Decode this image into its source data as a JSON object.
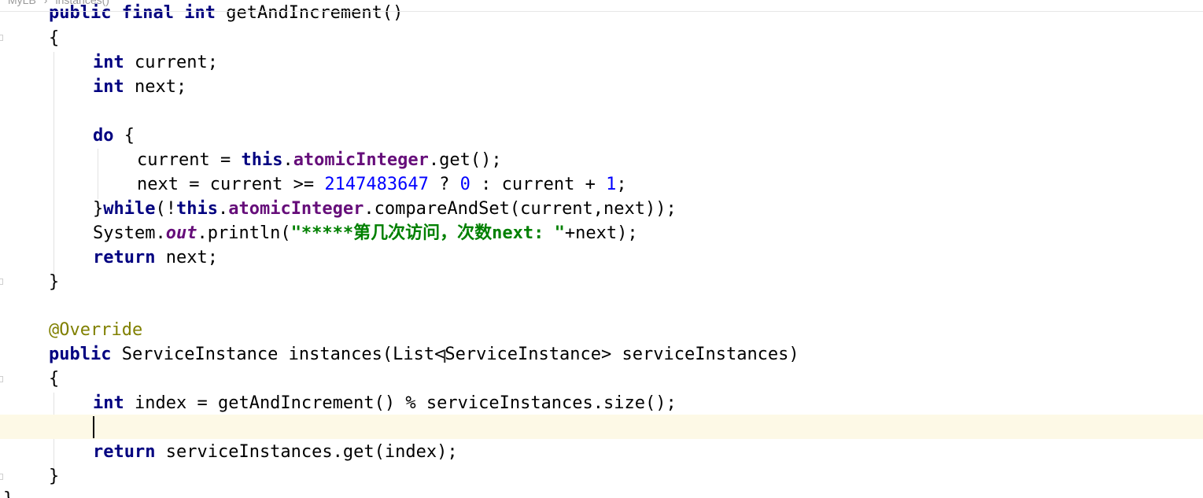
{
  "breadcrumb": [
    "MyLB",
    "instances()"
  ],
  "code": {
    "l0": {
      "kw1": "public",
      "kw2": "final",
      "kw3": "int",
      "rest": "getAndIncrement()"
    },
    "l1": {
      "text": "{"
    },
    "l2": {
      "kw": "int",
      "rest": "current;"
    },
    "l3": {
      "kw": "int",
      "rest": "next;"
    },
    "l5": {
      "kw": "do",
      "rest": "{"
    },
    "l6": {
      "a": "current = ",
      "this": "this",
      "dot": ".",
      "field": "atomicInteger",
      "rest": ".get();"
    },
    "l7": {
      "a": "next = current >= ",
      "num1": "2147483647",
      "b": " ? ",
      "num2": "0",
      "c": " : current + ",
      "num3": "1",
      "d": ";"
    },
    "l8": {
      "brace": "}",
      "while": "while",
      "a": "(!",
      "this": "this",
      "dot": ".",
      "field": "atomicInteger",
      "rest": ".compareAndSet(current,next));"
    },
    "l9": {
      "a": "System.",
      "out": "out",
      "b": ".println(",
      "str": "\"*****第几次访问，次数next: \"",
      "c": "+next);"
    },
    "l10": {
      "kw": "return",
      "rest": "next;"
    },
    "l11": {
      "text": "}"
    },
    "l13": {
      "ann": "@Override"
    },
    "l14": {
      "kw": "public",
      "rest": "ServiceInstance instances(List<ServiceInstance> serviceInstances)"
    },
    "l15": {
      "text": "{"
    },
    "l16": {
      "kw": "int",
      "rest": "index = getAndIncrement() % serviceInstances.size();"
    },
    "l18": {
      "kw": "return",
      "rest": "serviceInstances.get(index);"
    },
    "l19": {
      "text": "}"
    },
    "l20": {
      "text": "}"
    }
  }
}
